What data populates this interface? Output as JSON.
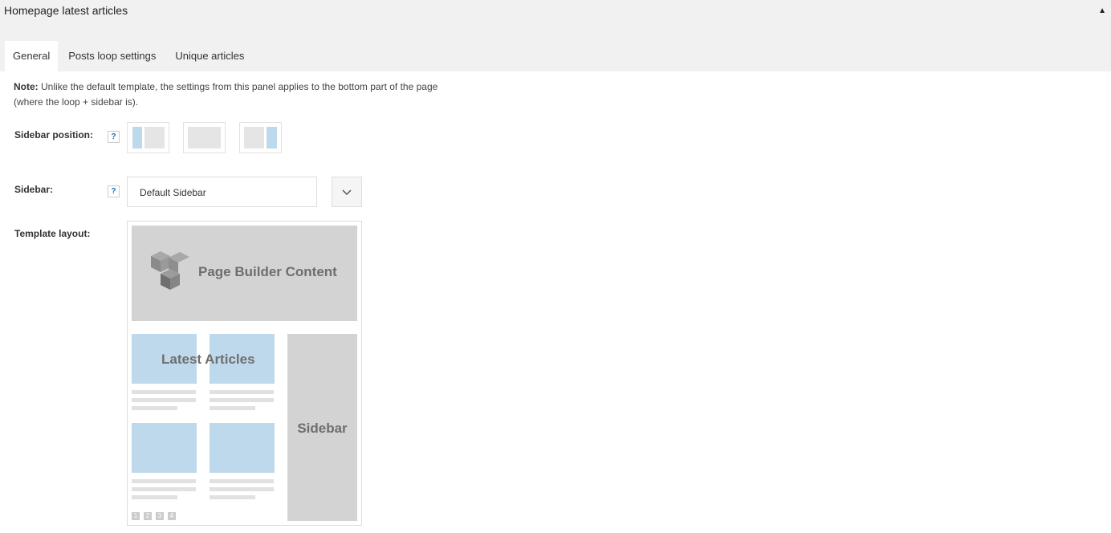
{
  "panel": {
    "title": "Homepage latest articles",
    "collapse_glyph": "▲",
    "tabs": [
      {
        "label": "General",
        "active": true
      },
      {
        "label": "Posts loop settings",
        "active": false
      },
      {
        "label": "Unique articles",
        "active": false
      }
    ]
  },
  "note": {
    "bold": "Note:",
    "text": "Unlike the default template, the settings from this panel applies to the bottom part of the page (where the loop + sidebar is)."
  },
  "sidebar_position": {
    "label": "Sidebar position:",
    "help": "?",
    "options": [
      "sidebar-left",
      "no-sidebar",
      "sidebar-right"
    ]
  },
  "sidebar": {
    "label": "Sidebar:",
    "help": "?",
    "selected": "Default Sidebar"
  },
  "template_layout": {
    "label": "Template layout:",
    "builder_text": "Page Builder Content",
    "articles_text": "Latest Articles",
    "sidebar_text": "Sidebar",
    "pages": [
      "1",
      "2",
      "3",
      "4"
    ]
  },
  "colors": {
    "header_bg": "#f1f1f1",
    "thumb_blue": "#bfd9ec",
    "block_gray": "#d3d3d3"
  }
}
